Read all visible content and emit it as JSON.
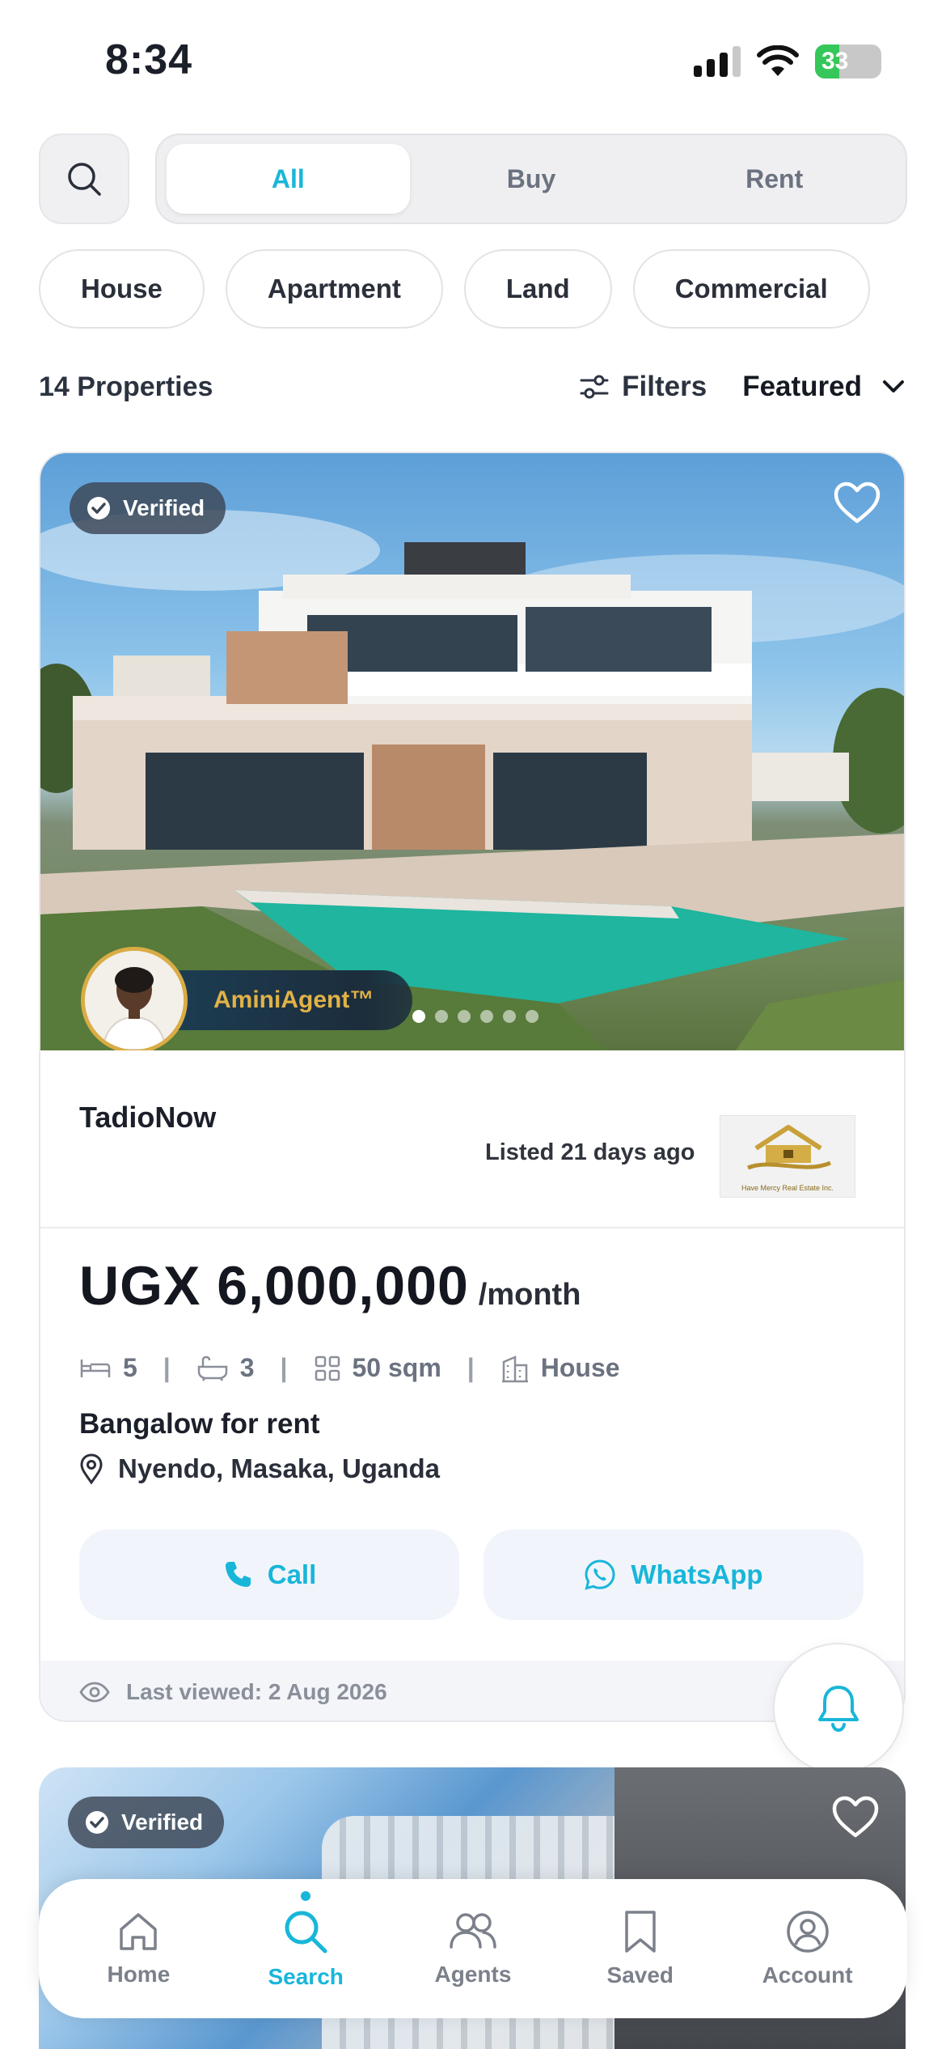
{
  "status_bar": {
    "time": "8:34",
    "battery": "33"
  },
  "search": {
    "icon": "search-icon"
  },
  "segment": {
    "options": [
      "All",
      "Buy",
      "Rent"
    ],
    "selected": "All"
  },
  "categories": [
    "House",
    "Apartment",
    "Land",
    "Commercial"
  ],
  "results": {
    "count_label": "14 Properties",
    "filters_label": "Filters",
    "sort_label": "Featured"
  },
  "listing": {
    "verified_label": "Verified",
    "agent_name": "AminiAgent™",
    "agency": "TadioNow",
    "listed": "Listed 21 days ago",
    "agency_logo_caption": "Have Mercy Real Estate Inc.",
    "price": "UGX 6,000,000",
    "period": "/month",
    "beds": "5",
    "baths": "3",
    "area": "50 sqm",
    "type": "House",
    "title": "Bangalow for rent",
    "location": "Nyendo, Masaka, Uganda",
    "call_label": "Call",
    "whatsapp_label": "WhatsApp",
    "last_viewed": "Last viewed: 2 Aug 2026",
    "photo_count": 6,
    "photo_index": 1
  },
  "listing2": {
    "verified_label": "Verified"
  },
  "nav": {
    "items": [
      {
        "label": "Home",
        "icon": "home-icon"
      },
      {
        "label": "Search",
        "icon": "search-icon"
      },
      {
        "label": "Agents",
        "icon": "agents-icon"
      },
      {
        "label": "Saved",
        "icon": "bookmark-icon"
      },
      {
        "label": "Account",
        "icon": "account-icon"
      }
    ],
    "active": "Search"
  },
  "colors": {
    "accent": "#18b6d9",
    "gold": "#d9ac45",
    "text": "#1b1f29",
    "muted": "#6b7280"
  }
}
